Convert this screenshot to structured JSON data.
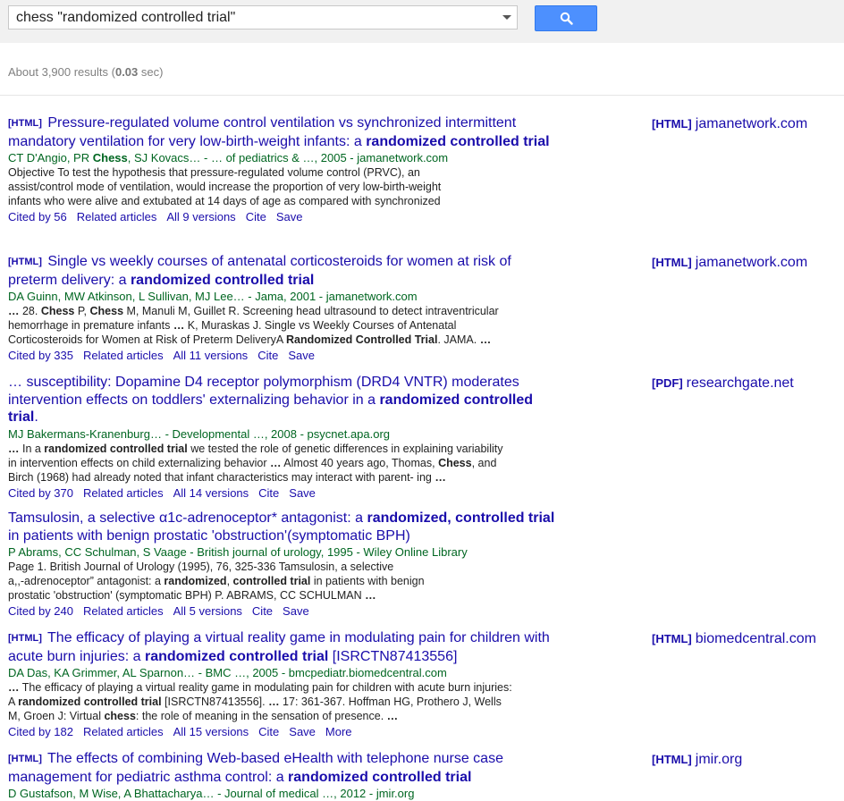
{
  "search": {
    "query": "chess \"randomized controlled trial\""
  },
  "stats": {
    "prefix": "About 3,900 results (",
    "time": "0.03",
    "suffix": " sec)"
  },
  "results": [
    {
      "tag": "[HTML]",
      "title_parts": [
        "Pressure-regulated volume control ventilation vs synchronized intermittent mandatory ventilation for very low-birth-weight infants: a ",
        "randomized controlled trial",
        ""
      ],
      "meta_parts": [
        "CT D'Angio, PR ",
        "Chess",
        ", SJ Kovacs… - … of pediatrics & …, 2005 - jamanetwork.com"
      ],
      "snippet_lines": [
        "Objective To test the hypothesis that pressure-regulated volume control (PRVC), an",
        "assist/control mode of ventilation, would increase the proportion of very low-birth-weight",
        "infants who were alive and extubated at 14 days of age as compared with synchronized"
      ],
      "links": [
        "Cited by 56",
        "Related articles",
        "All 9 versions",
        "Cite",
        "Save"
      ],
      "side": {
        "tag": "[HTML]",
        "domain": "jamanetwork.com"
      }
    },
    {
      "tag": "[HTML]",
      "title_parts": [
        "Single vs weekly courses of antenatal corticosteroids for women at risk of preterm delivery: a ",
        "randomized controlled trial",
        ""
      ],
      "meta_parts": [
        "DA Guinn, MW Atkinson, L Sullivan, MJ Lee… - Jama, 2001 - jamanetwork.com",
        "",
        ""
      ],
      "snippet_html": [
        [
          [
            "b",
            "…"
          ],
          [
            "t",
            " 28. "
          ],
          [
            "b",
            "Chess"
          ],
          [
            "t",
            " P, "
          ],
          [
            "b",
            "Chess"
          ],
          [
            "t",
            " M, Manuli M, Guillet R. Screening head ultrasound to detect intraventricular"
          ]
        ],
        [
          [
            "t",
            "hemorrhage in premature infants "
          ],
          [
            "b",
            "…"
          ],
          [
            "t",
            " K, Muraskas J. Single vs Weekly Courses of Antenatal"
          ]
        ],
        [
          [
            "t",
            "Corticosteroids for Women at Risk of Preterm DeliveryA "
          ],
          [
            "b",
            "Randomized Controlled Trial"
          ],
          [
            "t",
            ". JAMA. "
          ],
          [
            "b",
            "…"
          ]
        ]
      ],
      "links": [
        "Cited by 335",
        "Related articles",
        "All 11 versions",
        "Cite",
        "Save"
      ],
      "side": {
        "tag": "[HTML]",
        "domain": "jamanetwork.com"
      }
    },
    {
      "tag": "",
      "title_parts": [
        "… susceptibility: Dopamine D4 receptor polymorphism (DRD4 VNTR) moderates intervention effects on toddlers' externalizing behavior in a ",
        "randomized controlled trial",
        "."
      ],
      "meta_parts": [
        "MJ Bakermans-Kranenburg… - Developmental …, 2008 - psycnet.apa.org",
        "",
        ""
      ],
      "snippet_html": [
        [
          [
            "b",
            "…"
          ],
          [
            "t",
            " In a "
          ],
          [
            "b",
            "randomized controlled trial"
          ],
          [
            "t",
            " we tested the role of genetic differences in explaining variability"
          ]
        ],
        [
          [
            "t",
            "in intervention effects on child externalizing behavior "
          ],
          [
            "b",
            "…"
          ],
          [
            "t",
            " Almost 40 years ago, Thomas, "
          ],
          [
            "b",
            "Chess"
          ],
          [
            "t",
            ", and"
          ]
        ],
        [
          [
            "t",
            "Birch (1968) had already noted that infant characteristics may interact with parent- ing "
          ],
          [
            "b",
            "…"
          ]
        ]
      ],
      "links": [
        "Cited by 370",
        "Related articles",
        "All 14 versions",
        "Cite",
        "Save"
      ],
      "side": {
        "tag": "[PDF]",
        "domain": "researchgate.net"
      }
    },
    {
      "tag": "",
      "title_parts": [
        "Tamsulosin, a selective α1c-adrenoceptor* antagonist: a ",
        "randomized, controlled trial",
        " in patients with benign prostatic 'obstruction'(symptomatic BPH)"
      ],
      "meta_parts": [
        "P Abrams, CC Schulman, S Vaage - British journal of urology, 1995 - Wiley Online Library",
        "",
        ""
      ],
      "snippet_html": [
        [
          [
            "t",
            "Page 1. British Journal of Urology (1995), 76, 325-336 Tamsulosin, a selective"
          ]
        ],
        [
          [
            "t",
            "a,,-adrenoceptor” antagonist: a "
          ],
          [
            "b",
            "randomized"
          ],
          [
            "t",
            ", "
          ],
          [
            "b",
            "controlled trial"
          ],
          [
            "t",
            " in patients with benign"
          ]
        ],
        [
          [
            "t",
            "prostatic 'obstruction' (symptomatic BPH) P. ABRAMS, CC SCHULMAN "
          ],
          [
            "b",
            "…"
          ]
        ]
      ],
      "links": [
        "Cited by 240",
        "Related articles",
        "All 5 versions",
        "Cite",
        "Save"
      ],
      "side": null
    },
    {
      "tag": "[HTML]",
      "title_parts": [
        "The efficacy of playing a virtual reality game in modulating pain for children with acute burn injuries: a ",
        "randomized controlled trial",
        " [ISRCTN87413556]"
      ],
      "meta_parts": [
        "DA Das, KA Grimmer, AL Sparnon… - BMC …, 2005 - bmcpediatr.biomedcentral.com",
        "",
        ""
      ],
      "snippet_html": [
        [
          [
            "b",
            "…"
          ],
          [
            "t",
            " The efficacy of playing a virtual reality game in modulating pain for children with acute burn injuries:"
          ]
        ],
        [
          [
            "t",
            "A "
          ],
          [
            "b",
            "randomized controlled trial"
          ],
          [
            "t",
            " [ISRCTN87413556]. "
          ],
          [
            "b",
            "…"
          ],
          [
            "t",
            " 17: 361-367. Hoffman HG, Prothero J, Wells"
          ]
        ],
        [
          [
            "t",
            "M, Groen J: Virtual "
          ],
          [
            "b",
            "chess"
          ],
          [
            "t",
            ": the role of meaning in the sensation of presence. "
          ],
          [
            "b",
            "…"
          ]
        ]
      ],
      "links": [
        "Cited by 182",
        "Related articles",
        "All 15 versions",
        "Cite",
        "Save",
        "More"
      ],
      "side": {
        "tag": "[HTML]",
        "domain": "biomedcentral.com"
      }
    },
    {
      "tag": "[HTML]",
      "title_parts": [
        "The effects of combining Web-based eHealth with telephone nurse case management for pediatric asthma control: a ",
        "randomized controlled trial",
        ""
      ],
      "meta_parts": [
        "D Gustafson, M Wise, A Bhattacharya… - Journal of medical …, 2012 - jmir.org",
        "",
        ""
      ],
      "snippet_html": [],
      "links": [],
      "side": {
        "tag": "[HTML]",
        "domain": "jmir.org"
      }
    }
  ]
}
